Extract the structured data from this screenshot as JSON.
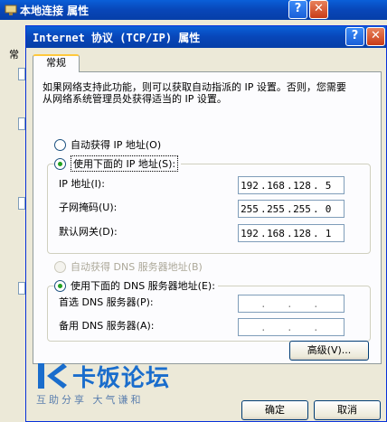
{
  "background_window": {
    "title": "本地连接 属性",
    "tab_fragment": "常",
    "help": "?",
    "close": "✕"
  },
  "dialog": {
    "title": "Internet 协议 (TCP/IP) 属性",
    "help": "?",
    "close": "✕",
    "tab": "常规",
    "description": "如果网络支持此功能，则可以获取自动指派的 IP 设置。否则，您需要从网络系统管理员处获得适当的 IP 设置。",
    "ip_mode": {
      "auto_label": "自动获得 IP 地址(O)",
      "manual_label": "使用下面的 IP 地址(S):",
      "selected": "manual"
    },
    "ip_fields": [
      {
        "label": "IP 地址(I):",
        "octets": [
          "192",
          "168",
          "128",
          "5"
        ]
      },
      {
        "label": "子网掩码(U):",
        "octets": [
          "255",
          "255",
          "255",
          "0"
        ]
      },
      {
        "label": "默认网关(D):",
        "octets": [
          "192",
          "168",
          "128",
          "1"
        ]
      }
    ],
    "dns_mode": {
      "auto_label": "自动获得 DNS 服务器地址(B)",
      "manual_label": "使用下面的 DNS 服务器地址(E):",
      "selected": "manual"
    },
    "dns_fields": [
      {
        "label": "首选 DNS 服务器(P):",
        "octets": [
          "",
          "",
          "",
          ""
        ]
      },
      {
        "label": "备用 DNS 服务器(A):",
        "octets": [
          "",
          "",
          "",
          ""
        ]
      }
    ],
    "advanced_button": "高级(V)...",
    "ok_button": "确定",
    "cancel_button": "取消"
  },
  "watermark": {
    "brand": "卡饭论坛",
    "tagline": "互助分享 大气谦和"
  },
  "colors": {
    "titlebar": "#0846b8",
    "window_bg": "#ece9d8",
    "radio_dot": "#21a121",
    "watermark": "#1a6dcc"
  }
}
